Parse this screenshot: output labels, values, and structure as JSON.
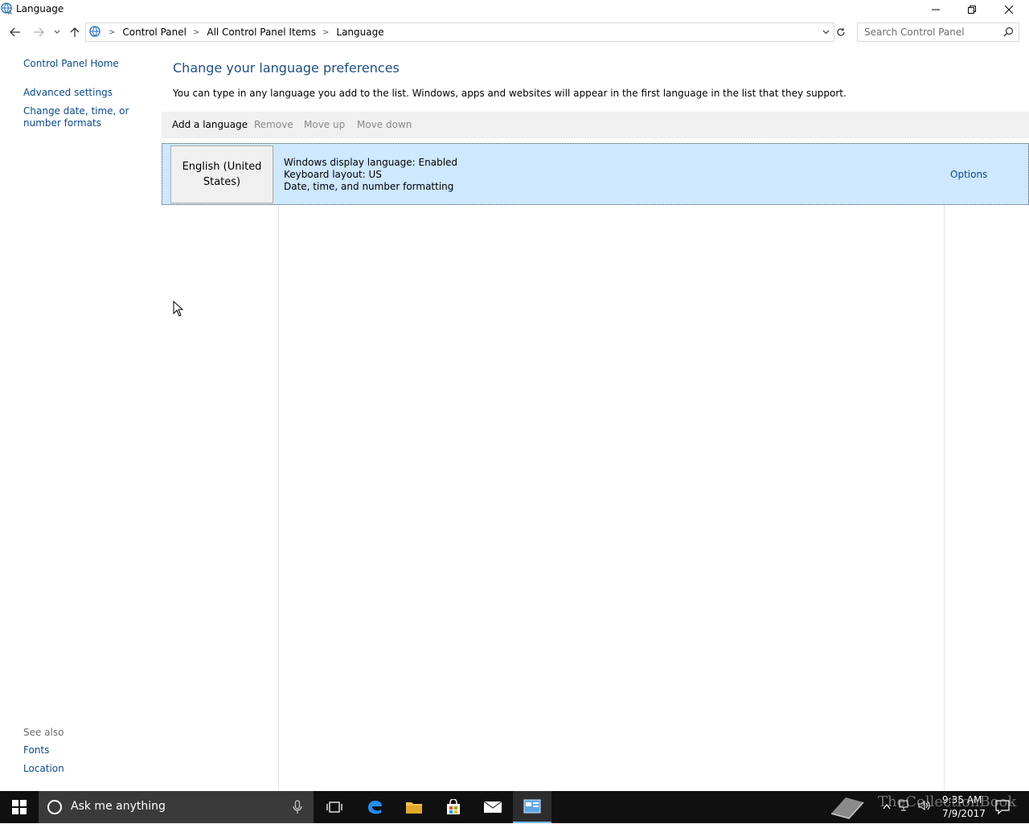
{
  "window": {
    "title": "Language"
  },
  "address": {
    "breadcrumbs": [
      "Control Panel",
      "All Control Panel Items",
      "Language"
    ]
  },
  "search": {
    "placeholder": "Search Control Panel"
  },
  "left_pane": {
    "home": "Control Panel Home",
    "links": [
      "Advanced settings",
      "Change date, time, or number formats"
    ],
    "see_also_label": "See also",
    "see_also_links": [
      "Fonts",
      "Location"
    ]
  },
  "main": {
    "heading": "Change your language preferences",
    "description": "You can type in any language you add to the list. Windows, apps and websites will appear in the first language in the list that they support.",
    "toolbar": {
      "add": "Add a language",
      "remove": "Remove",
      "move_up": "Move up",
      "move_down": "Move down"
    },
    "languages": [
      {
        "name": "English (United States)",
        "details": [
          "Windows display language: Enabled",
          "Keyboard layout: US",
          "Date, time, and number formatting"
        ],
        "options": "Options"
      }
    ]
  },
  "taskbar": {
    "search_placeholder": "Ask me anything",
    "time": "9:35 AM",
    "date": "7/9/2017",
    "watermark": "TheCollectionBook"
  },
  "colors": {
    "link": "#0b4a8b",
    "heading": "#1e4e86",
    "selection": "#cde8ff",
    "taskbar": "#101010"
  }
}
